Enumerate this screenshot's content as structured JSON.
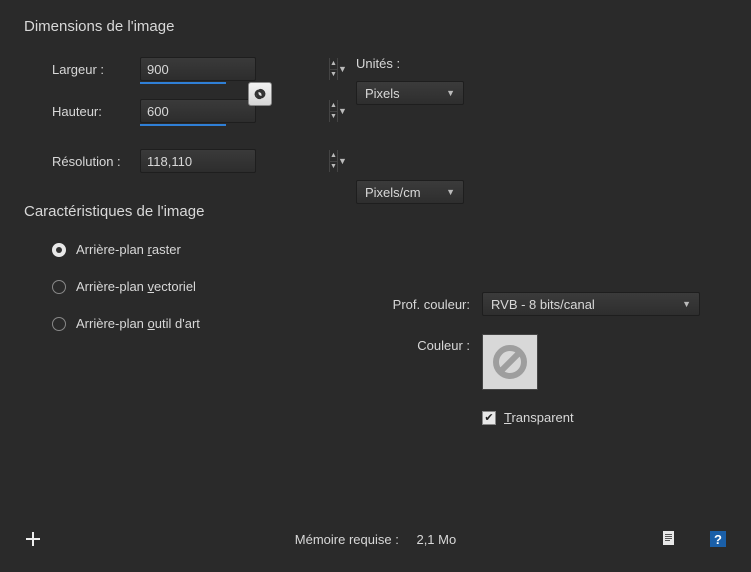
{
  "sections": {
    "dimensions": {
      "title": "Dimensions de l'image",
      "width_label": "Largeur :",
      "width_value": "900",
      "height_label": "Hauteur:",
      "height_value": "600",
      "resolution_label": "Résolution :",
      "resolution_value": "118,110",
      "units_label": "Unités :",
      "units_value": "Pixels",
      "resolution_units": "Pixels/cm"
    },
    "characteristics": {
      "title": "Caractéristiques de l'image",
      "bg_raster": "Arrière-plan raster",
      "bg_vector": "Arrière-plan vectoriel",
      "bg_art": "Arrière-plan outil d'art",
      "depth_label": "Prof. couleur:",
      "depth_value": "RVB - 8 bits/canal",
      "color_label": "Couleur :",
      "transparent_label": "Transparent"
    }
  },
  "footer": {
    "memory_label": "Mémoire requise :",
    "memory_value": "2,1 Mo"
  }
}
